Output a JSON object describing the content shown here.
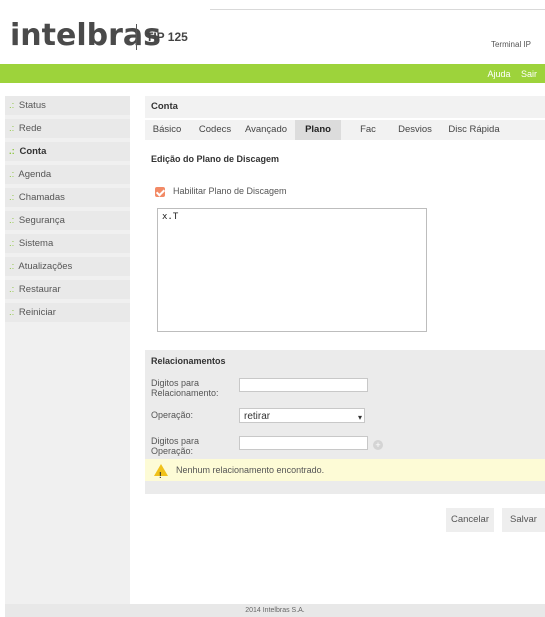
{
  "header": {
    "logo": "intelbras",
    "model": "TIP 125",
    "subtitle": "Terminal IP"
  },
  "topbar": {
    "links": [
      "Ajuda",
      "Sair"
    ]
  },
  "sidebar": {
    "prefix": ".:",
    "items": [
      {
        "label": "Status"
      },
      {
        "label": "Rede"
      },
      {
        "label": "Conta"
      },
      {
        "label": "Agenda"
      },
      {
        "label": "Chamadas"
      },
      {
        "label": "Segurança"
      },
      {
        "label": "Sistema"
      },
      {
        "label": "Atualizações"
      },
      {
        "label": "Restaurar"
      },
      {
        "label": "Reiniciar"
      }
    ],
    "active_index": 2
  },
  "main": {
    "section_title": "Conta",
    "tabs": [
      {
        "label": "Básico"
      },
      {
        "label": "Codecs"
      },
      {
        "label": "Avançado"
      },
      {
        "label": "Plano"
      },
      {
        "label": "Fac"
      },
      {
        "label": "Desvios"
      },
      {
        "label": "Disc Rápida"
      }
    ],
    "active_tab": "Plano",
    "plan_title": "Edição do Plano de Discagem",
    "enable_label": "Habilitar Plano de Discagem",
    "enable_checked": true,
    "plan_text": "x.T"
  },
  "relations": {
    "title": "Relacionamentos",
    "digits_label": "Digitos para Relacionamento:",
    "digits_value": "",
    "operation_label": "Operação:",
    "operation_value": "retirar",
    "op_digits_label": "Digitos para Operação:",
    "op_digits_value": "",
    "empty_message": "Nenhum relacionamento encontrado."
  },
  "actions": {
    "cancel": "Cancelar",
    "save": "Salvar"
  },
  "footer": {
    "text": "2014 Intelbras S.A."
  },
  "colors": {
    "accent_green": "#9dd33b",
    "checkbox": "#f28a66",
    "warning_bg": "#fdfbd6"
  }
}
